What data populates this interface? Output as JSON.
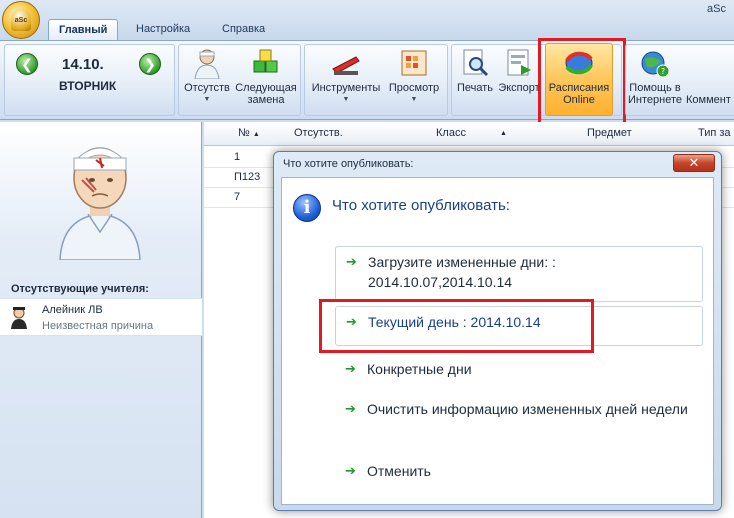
{
  "app": {
    "name": "aSc",
    "orb_text": "aSc"
  },
  "menu": {
    "tabs": [
      "Главный",
      "Настройка",
      "Справка"
    ],
    "active_tab": "Главный"
  },
  "ribbon": {
    "date": "14.10.",
    "weekday": "ВТОРНИК",
    "buttons": {
      "absent": "Отсутств",
      "next_substitution": "Следующая замена",
      "tools": "Инструменты",
      "preview": "Просмотр",
      "print": "Печать",
      "export": "Экспорт",
      "online": "Расписания Online",
      "help_internet": "Помощь в Интернете",
      "comments": "Коммент"
    }
  },
  "left_panel": {
    "absent_title": "Отсутствующие учителя:",
    "teacher_name": "Алейник ЛВ",
    "teacher_reason": "Неизвестная причина"
  },
  "grid": {
    "columns": [
      "№",
      "Отсутств.",
      "Класс",
      "Предмет",
      "Тип за"
    ],
    "rows": [
      "1",
      "П123",
      "7"
    ]
  },
  "dialog": {
    "title": "Что хотите опубликовать:",
    "close": "✕",
    "heading": "Что хотите опубликовать:",
    "options": [
      "Загрузите измененные дни: : 2014.10.07,2014.10.14",
      "Текущий день : 2014.10.14",
      "Конкретные дни",
      "Очистить информацию измененных дней недели",
      "Отменить"
    ]
  },
  "colors": {
    "accent": "#1a3f8a",
    "highlight": "#e01b24",
    "arrow": "#1f9a2a",
    "online_button": "#ffc65a"
  }
}
